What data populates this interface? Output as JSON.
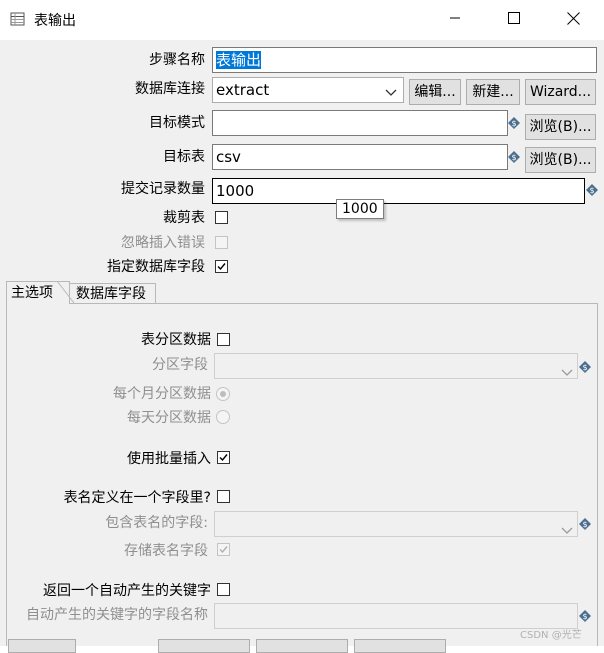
{
  "window": {
    "title": "表输出",
    "controls": [
      "minimize-icon",
      "maximize-icon",
      "close-icon"
    ]
  },
  "form": {
    "step_name": {
      "label": "步骤名称",
      "value": "表输出"
    },
    "db_connection": {
      "label": "数据库连接",
      "value": "extract",
      "edit_button": "编辑...",
      "new_button": "新建...",
      "wizard_button": "Wizard..."
    },
    "target_schema": {
      "label": "目标模式",
      "value": "",
      "browse_button": "浏览(B)..."
    },
    "target_table": {
      "label": "目标表",
      "value": "csv",
      "browse_button": "浏览(B)..."
    },
    "commit_size": {
      "label": "提交记录数量",
      "value": "1000",
      "tooltip": "1000"
    },
    "truncate_table": {
      "label": "裁剪表",
      "checked": false
    },
    "ignore_insert_errors": {
      "label": "忽略插入错误",
      "checked": false,
      "disabled": true
    },
    "specify_db_fields": {
      "label": "指定数据库字段",
      "checked": true
    }
  },
  "tabs": [
    {
      "label": "主选项",
      "active": true
    },
    {
      "label": "数据库字段",
      "active": false
    }
  ],
  "main_options": {
    "partition_data": {
      "label": "表分区数据",
      "checked": false
    },
    "partition_field": {
      "label": "分区字段",
      "value": ""
    },
    "partition_monthly": {
      "label": "每个月分区数据",
      "selected": true
    },
    "partition_daily": {
      "label": "每天分区数据",
      "selected": false
    },
    "use_batch_insert": {
      "label": "使用批量插入",
      "checked": true
    },
    "table_name_in_field": {
      "label": "表名定义在一个字段里?",
      "checked": false
    },
    "table_name_field": {
      "label": "包含表名的字段:",
      "value": ""
    },
    "store_table_name_field": {
      "label": "存储表名字段",
      "checked": true
    },
    "return_generated_key": {
      "label": "返回一个自动产生的关键字",
      "checked": false
    },
    "generated_key_field": {
      "label": "自动产生的关键字的字段名称",
      "value": ""
    }
  },
  "watermark": "CSDN @光芒",
  "colors": {
    "selection": "#0078d7",
    "dialog_bg": "#f0f0f0",
    "variable_icon": "#4a6f8f"
  }
}
